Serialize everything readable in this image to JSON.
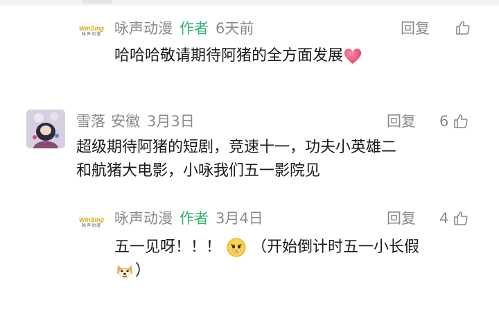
{
  "comments": [
    {
      "author": "咏声动漫",
      "tag": "作者",
      "time": "6天前",
      "location": "",
      "reply_label": "回复",
      "likes": "",
      "text": "哈哈哈敬请期待阿猪的全方面发展"
    },
    {
      "author": "雪落",
      "tag": "",
      "time": "3月3日",
      "location": "安徽",
      "reply_label": "回复",
      "likes": "6",
      "text_line1": "超级期待阿猪的短剧，竞速十一，功夫小英雄二",
      "text_line2": "和航猪大电影，小咏我们五一影院见"
    },
    {
      "author": "咏声动漫",
      "tag": "作者",
      "time": "3月4日",
      "location": "",
      "reply_label": "回复",
      "likes": "4",
      "text_part1": "五一见呀！！！",
      "text_part2": "（开始倒计时五一小长假",
      "text_part3": "）"
    }
  ],
  "logo": {
    "top": "WinSing",
    "bottom": "咏声动漫"
  },
  "colors": {
    "author_tag": "#2fb36b",
    "meta": "#8a8a8a",
    "heart": "#e8476a"
  },
  "icons": {
    "like": "thumbs-up-icon",
    "heart": "heart-emoji-icon",
    "grin": "grin-emoji-icon",
    "doge": "doge-emoji-icon"
  }
}
